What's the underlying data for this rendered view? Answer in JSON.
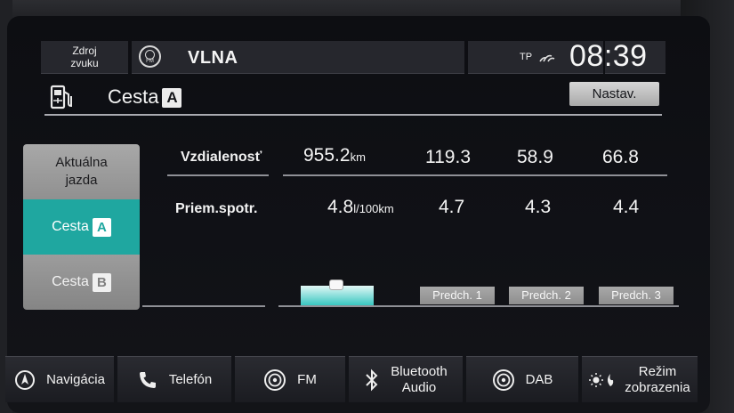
{
  "status_bar": {
    "source_label_line1": "Zdroj",
    "source_label_line2": "zvuku",
    "band_icon_text": "FM",
    "station": "VLNA",
    "tp": "TP",
    "clock": "08:39"
  },
  "header": {
    "title": "Cesta",
    "trip_letter": "A",
    "settings_label": "Nastav."
  },
  "tabs": [
    {
      "label_line1": "Aktuálna",
      "label_line2": "jazda",
      "active": false
    },
    {
      "label": "Cesta",
      "letter": "A",
      "active": true
    },
    {
      "label": "Cesta",
      "letter": "B",
      "active": false
    }
  ],
  "table": {
    "distance_label": "Vzdialenosť",
    "consumption_label": "Priem.spotr.",
    "distance_current": "955.2",
    "distance_unit": "km",
    "consumption_current": "4.8",
    "consumption_unit": "l/100km",
    "distance_prev": [
      "119.3",
      "58.9",
      "66.8"
    ],
    "consumption_prev": [
      "4.7",
      "4.3",
      "4.4"
    ]
  },
  "history_buttons": [
    "Predch. 1",
    "Predch. 2",
    "Predch. 3"
  ],
  "bottom_nav": [
    {
      "label": "Navigácia",
      "icon": "navigation-icon"
    },
    {
      "label": "Telefón",
      "icon": "phone-icon"
    },
    {
      "label": "FM",
      "icon": "radio-icon"
    },
    {
      "label_line1": "Bluetooth",
      "label_line2": "Audio",
      "icon": "bluetooth-icon"
    },
    {
      "label": "DAB",
      "icon": "radio-icon"
    },
    {
      "label_line1": "Režim",
      "label_line2": "zobrazenia",
      "icon": "display-mode-icon"
    }
  ],
  "colors": {
    "accent": "#1fa7a0",
    "screen_bg": "#0f1014",
    "tab_grey": "#9a9a9a",
    "settings_button": "#c4c4c4"
  }
}
